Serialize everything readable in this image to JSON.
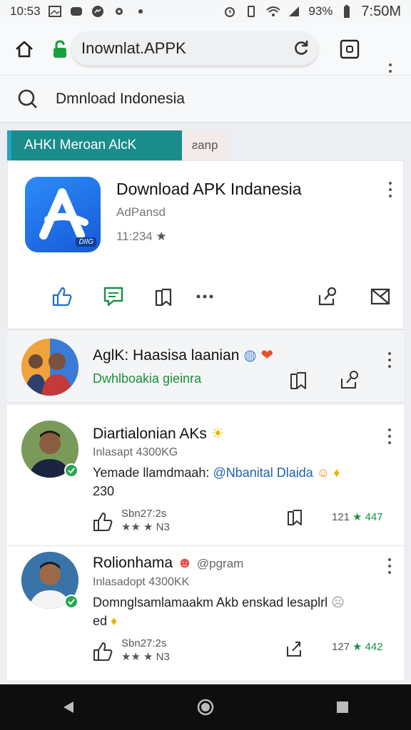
{
  "status_bar": {
    "time_left": "10:53",
    "battery": "93%",
    "time_right": "7:50M"
  },
  "browser": {
    "url": "Inownlat.APPK",
    "search_query": "Dmnload Indonesia"
  },
  "tabs": {
    "active_label": "AHKI Meroan AlcK",
    "other_label": "ƨanp"
  },
  "app": {
    "title": "Download APK Indanesia",
    "subtitle": "AdPansd",
    "rating": "11:234",
    "icon_badge": "DIIG",
    "brand_color": "#1e6fe8"
  },
  "notification": {
    "title": "AglK: Haasisa laanian",
    "subtitle": "Dwhlboakia gieinra"
  },
  "comments": [
    {
      "name": "Diartialonian AKs",
      "meta": "Inlasapt 4300KG",
      "body_text": "Yemade llamdmaah: ",
      "body_link": "@Nbanital Dlaida",
      "body_tail": "",
      "body_line2": "230",
      "date": "Sbn27:2s",
      "date_sub": "★★ ★ N3",
      "count_left": "121",
      "count_right": "447"
    },
    {
      "name": "Rolionhama",
      "handle": "@pgram",
      "meta": "Inlasadopt 4300KK",
      "body_text": "Domnglsamlamaakm Akb enskad lesaplrl",
      "body_link": "",
      "body_tail": "",
      "body_line2": "ed",
      "date": "Sbn27:2s",
      "date_sub": "★★ ★ N3",
      "count_left": "127",
      "count_right": "442"
    }
  ]
}
